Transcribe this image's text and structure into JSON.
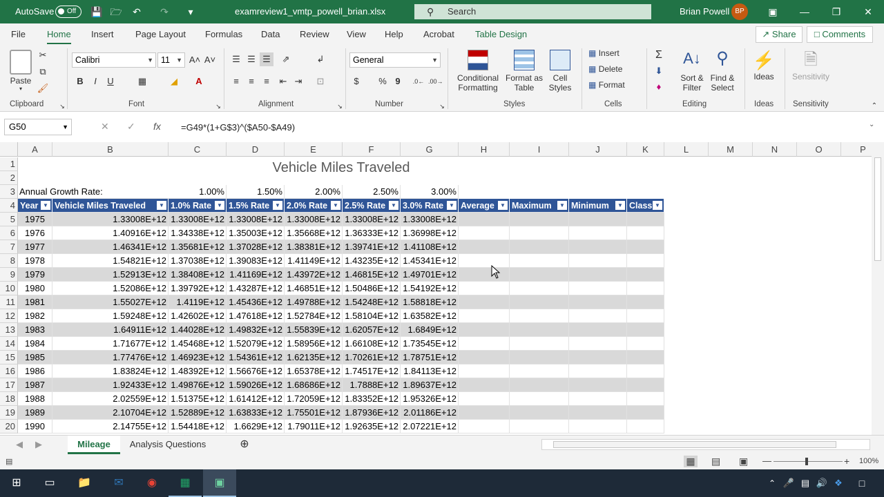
{
  "titlebar": {
    "autosave_label": "AutoSave",
    "autosave_state": "Off",
    "filename": "examreview1_vmtp_powell_brian.xlsx",
    "search_placeholder": "Search",
    "user_name": "Brian Powell",
    "user_initials": "BP",
    "accent": "#217346"
  },
  "menu": {
    "items": [
      "File",
      "Home",
      "Insert",
      "Page Layout",
      "Formulas",
      "Data",
      "Review",
      "View",
      "Help",
      "Acrobat",
      "Table Design"
    ],
    "active": "Home",
    "share": "Share",
    "comments": "Comments"
  },
  "ribbon": {
    "clipboard": {
      "paste": "Paste",
      "label": "Clipboard"
    },
    "font": {
      "name": "Calibri",
      "size": "11",
      "bold": "B",
      "italic": "I",
      "underline": "U",
      "label": "Font"
    },
    "alignment": {
      "label": "Alignment"
    },
    "number": {
      "format": "General",
      "label": "Number"
    },
    "styles": {
      "conditional": "Conditional",
      "conditional2": "Formatting",
      "format_as": "Format as",
      "format_as2": "Table",
      "cell": "Cell",
      "cell2": "Styles",
      "label": "Styles"
    },
    "cells": {
      "insert": "Insert",
      "delete": "Delete",
      "format": "Format",
      "label": "Cells"
    },
    "editing": {
      "sort": "Sort &",
      "sort2": "Filter",
      "find": "Find &",
      "find2": "Select",
      "label": "Editing"
    },
    "ideas": {
      "button": "Ideas",
      "label": "Ideas"
    },
    "sensitivity": {
      "button": "Sensitivity",
      "label": "Sensitivity"
    }
  },
  "formula_bar": {
    "name_box": "G50",
    "formula": "=G49*(1+G$3)^($A50-$A49)"
  },
  "sheet": {
    "columns": [
      "A",
      "B",
      "C",
      "D",
      "E",
      "F",
      "G",
      "H",
      "I",
      "J",
      "K",
      "L",
      "M",
      "N",
      "O",
      "P"
    ],
    "title": "Vehicle Miles Traveled",
    "growth_label": "Annual Growth Rate:",
    "rates": [
      "1.00%",
      "1.50%",
      "2.00%",
      "2.50%",
      "3.00%"
    ],
    "headers": [
      "Year",
      "Vehicle Miles Traveled",
      "1.0% Rate",
      "1.5% Rate",
      "2.0% Rate",
      "2.5% Rate",
      "3.0% Rate",
      "Average",
      "Maximum",
      "Minimum",
      "Class"
    ],
    "header_color": "#2f5597",
    "band_color": "#d9d9d9",
    "rows": [
      {
        "year": "1975",
        "vmt": "1.33008E+12",
        "r1": "1.33008E+12",
        "r15": "1.33008E+12",
        "r2": "1.33008E+12",
        "r25": "1.33008E+12",
        "r3": "1.33008E+12"
      },
      {
        "year": "1976",
        "vmt": "1.40916E+12",
        "r1": "1.34338E+12",
        "r15": "1.35003E+12",
        "r2": "1.35668E+12",
        "r25": "1.36333E+12",
        "r3": "1.36998E+12"
      },
      {
        "year": "1977",
        "vmt": "1.46341E+12",
        "r1": "1.35681E+12",
        "r15": "1.37028E+12",
        "r2": "1.38381E+12",
        "r25": "1.39741E+12",
        "r3": "1.41108E+12"
      },
      {
        "year": "1978",
        "vmt": "1.54821E+12",
        "r1": "1.37038E+12",
        "r15": "1.39083E+12",
        "r2": "1.41149E+12",
        "r25": "1.43235E+12",
        "r3": "1.45341E+12"
      },
      {
        "year": "1979",
        "vmt": "1.52913E+12",
        "r1": "1.38408E+12",
        "r15": "1.41169E+12",
        "r2": "1.43972E+12",
        "r25": "1.46815E+12",
        "r3": "1.49701E+12"
      },
      {
        "year": "1980",
        "vmt": "1.52086E+12",
        "r1": "1.39792E+12",
        "r15": "1.43287E+12",
        "r2": "1.46851E+12",
        "r25": "1.50486E+12",
        "r3": "1.54192E+12"
      },
      {
        "year": "1981",
        "vmt": "1.55027E+12",
        "r1": "1.4119E+12",
        "r15": "1.45436E+12",
        "r2": "1.49788E+12",
        "r25": "1.54248E+12",
        "r3": "1.58818E+12"
      },
      {
        "year": "1982",
        "vmt": "1.59248E+12",
        "r1": "1.42602E+12",
        "r15": "1.47618E+12",
        "r2": "1.52784E+12",
        "r25": "1.58104E+12",
        "r3": "1.63582E+12"
      },
      {
        "year": "1983",
        "vmt": "1.64911E+12",
        "r1": "1.44028E+12",
        "r15": "1.49832E+12",
        "r2": "1.55839E+12",
        "r25": "1.62057E+12",
        "r3": "1.6849E+12"
      },
      {
        "year": "1984",
        "vmt": "1.71677E+12",
        "r1": "1.45468E+12",
        "r15": "1.52079E+12",
        "r2": "1.58956E+12",
        "r25": "1.66108E+12",
        "r3": "1.73545E+12"
      },
      {
        "year": "1985",
        "vmt": "1.77476E+12",
        "r1": "1.46923E+12",
        "r15": "1.54361E+12",
        "r2": "1.62135E+12",
        "r25": "1.70261E+12",
        "r3": "1.78751E+12"
      },
      {
        "year": "1986",
        "vmt": "1.83824E+12",
        "r1": "1.48392E+12",
        "r15": "1.56676E+12",
        "r2": "1.65378E+12",
        "r25": "1.74517E+12",
        "r3": "1.84113E+12"
      },
      {
        "year": "1987",
        "vmt": "1.92433E+12",
        "r1": "1.49876E+12",
        "r15": "1.59026E+12",
        "r2": "1.68686E+12",
        "r25": "1.7888E+12",
        "r3": "1.89637E+12"
      },
      {
        "year": "1988",
        "vmt": "2.02559E+12",
        "r1": "1.51375E+12",
        "r15": "1.61412E+12",
        "r2": "1.72059E+12",
        "r25": "1.83352E+12",
        "r3": "1.95326E+12"
      },
      {
        "year": "1989",
        "vmt": "2.10704E+12",
        "r1": "1.52889E+12",
        "r15": "1.63833E+12",
        "r2": "1.75501E+12",
        "r25": "1.87936E+12",
        "r3": "2.01186E+12"
      },
      {
        "year": "1990",
        "vmt": "2.14755E+12",
        "r1": "1.54418E+12",
        "r15": "1.6629E+12",
        "r2": "1.79011E+12",
        "r25": "1.92635E+12",
        "r3": "2.07221E+12"
      }
    ]
  },
  "sheet_tabs": {
    "tabs": [
      "Mileage",
      "Analysis Questions"
    ],
    "active": "Mileage"
  },
  "status": {
    "zoom": "100%"
  }
}
